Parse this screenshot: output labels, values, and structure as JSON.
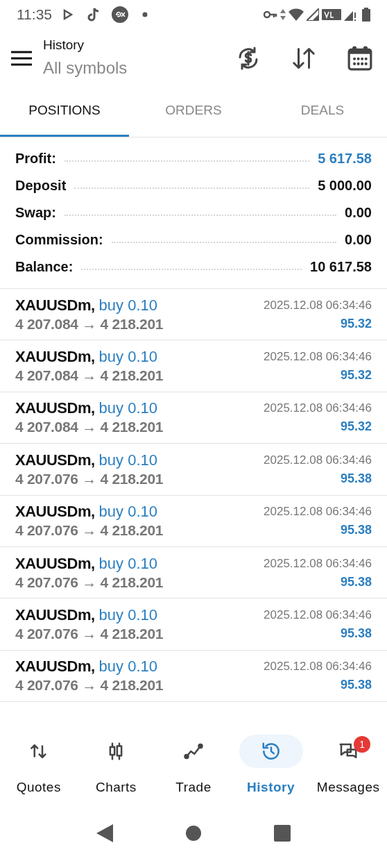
{
  "status_bar": {
    "time": "11:35"
  },
  "header": {
    "title": "History",
    "subtitle": "All symbols"
  },
  "tabs": [
    {
      "label": "POSITIONS",
      "selected": true
    },
    {
      "label": "ORDERS",
      "selected": false
    },
    {
      "label": "DEALS",
      "selected": false
    }
  ],
  "summary": [
    {
      "label": "Profit:",
      "value": "5 617.58",
      "highlight": true
    },
    {
      "label": "Deposit",
      "value": "5 000.00",
      "highlight": false
    },
    {
      "label": "Swap:",
      "value": "0.00",
      "highlight": false
    },
    {
      "label": "Commission:",
      "value": "0.00",
      "highlight": false
    },
    {
      "label": "Balance:",
      "value": "10 617.58",
      "highlight": false
    }
  ],
  "positions": [
    {
      "symbol": "XAUUSDm,",
      "side": "buy 0.10",
      "prices": "4 207.084 → 4 218.201",
      "time": "2025.12.08 06:34:46",
      "profit": "95.32"
    },
    {
      "symbol": "XAUUSDm,",
      "side": "buy 0.10",
      "prices": "4 207.084 → 4 218.201",
      "time": "2025.12.08 06:34:46",
      "profit": "95.32"
    },
    {
      "symbol": "XAUUSDm,",
      "side": "buy 0.10",
      "prices": "4 207.084 → 4 218.201",
      "time": "2025.12.08 06:34:46",
      "profit": "95.32"
    },
    {
      "symbol": "XAUUSDm,",
      "side": "buy 0.10",
      "prices": "4 207.076 → 4 218.201",
      "time": "2025.12.08 06:34:46",
      "profit": "95.38"
    },
    {
      "symbol": "XAUUSDm,",
      "side": "buy 0.10",
      "prices": "4 207.076 → 4 218.201",
      "time": "2025.12.08 06:34:46",
      "profit": "95.38"
    },
    {
      "symbol": "XAUUSDm,",
      "side": "buy 0.10",
      "prices": "4 207.076 → 4 218.201",
      "time": "2025.12.08 06:34:46",
      "profit": "95.38"
    },
    {
      "symbol": "XAUUSDm,",
      "side": "buy 0.10",
      "prices": "4 207.076 → 4 218.201",
      "time": "2025.12.08 06:34:46",
      "profit": "95.38"
    },
    {
      "symbol": "XAUUSDm,",
      "side": "buy 0.10",
      "prices": "4 207.076 → 4 218.201",
      "time": "2025.12.08 06:34:46",
      "profit": "95.38"
    }
  ],
  "nav": [
    {
      "label": "Quotes",
      "kind": "quotes",
      "selected": false
    },
    {
      "label": "Charts",
      "kind": "charts",
      "selected": false
    },
    {
      "label": "Trade",
      "kind": "trade",
      "selected": false
    },
    {
      "label": "History",
      "kind": "history",
      "selected": true
    },
    {
      "label": "Messages",
      "kind": "messages",
      "selected": false,
      "badge": "1"
    }
  ]
}
